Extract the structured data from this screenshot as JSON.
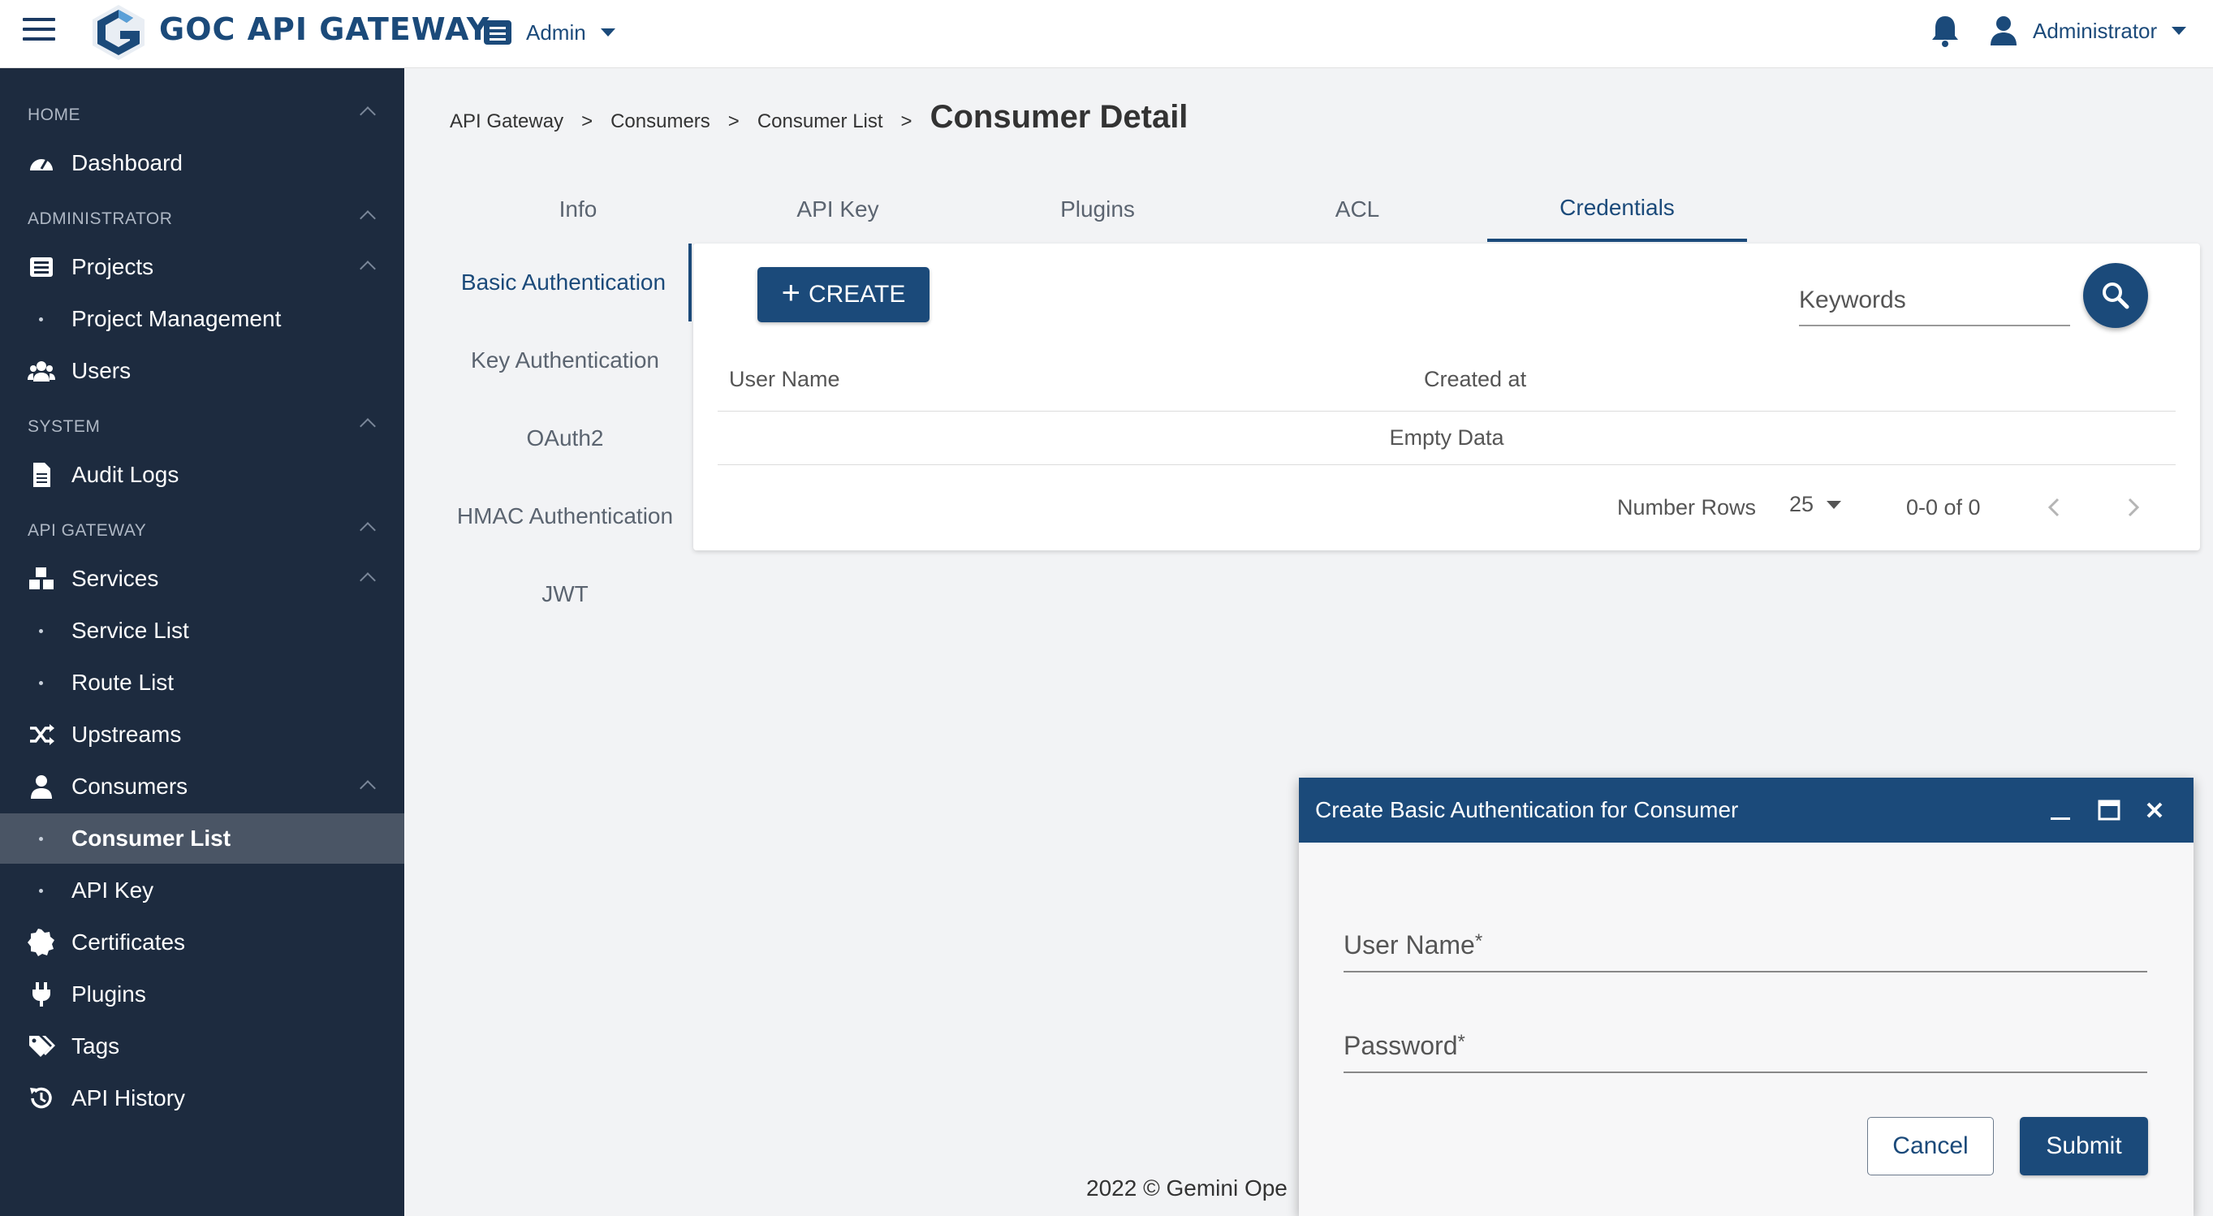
{
  "header": {
    "brand": "GOC API GATEWAY",
    "workspace_label": "Admin",
    "user_label": "Administrator",
    "colors": {
      "primary": "#1b4a7a",
      "sidebar_bg": "#1d2b3f",
      "sidebar_active": "#4a5565"
    }
  },
  "sidebar": {
    "sections": {
      "home": "HOME",
      "administrator": "ADMINISTRATOR",
      "system": "SYSTEM",
      "api_gateway": "API GATEWAY"
    },
    "items": {
      "dashboard": "Dashboard",
      "projects": "Projects",
      "project_management": "Project Management",
      "users": "Users",
      "audit_logs": "Audit Logs",
      "services": "Services",
      "service_list": "Service List",
      "route_list": "Route List",
      "upstreams": "Upstreams",
      "consumers": "Consumers",
      "consumer_list": "Consumer List",
      "api_key": "API Key",
      "certificates": "Certificates",
      "plugins": "Plugins",
      "tags": "Tags",
      "api_history": "API History"
    }
  },
  "breadcrumb": {
    "items": [
      "API Gateway",
      "Consumers",
      "Consumer List"
    ],
    "separator": ">",
    "current": "Consumer Detail"
  },
  "tabs": [
    "Info",
    "API Key",
    "Plugins",
    "ACL",
    "Credentials"
  ],
  "vertical_tabs": [
    "Basic Authentication",
    "Key Authentication",
    "OAuth2",
    "HMAC Authentication",
    "JWT"
  ],
  "card": {
    "create_label": "CREATE",
    "search_placeholder": "Keywords",
    "columns": [
      "User Name",
      "Created at"
    ],
    "empty_text": "Empty Data",
    "rows_label": "Number Rows",
    "rows_value": "25",
    "range_text": "0-0 of 0"
  },
  "footer": {
    "text": "2022 © Gemini Ope"
  },
  "dialog": {
    "title": "Create Basic Authentication for Consumer",
    "fields": {
      "username": "User Name",
      "password": "Password",
      "required_mark": "*"
    },
    "cancel_label": "Cancel",
    "submit_label": "Submit"
  }
}
